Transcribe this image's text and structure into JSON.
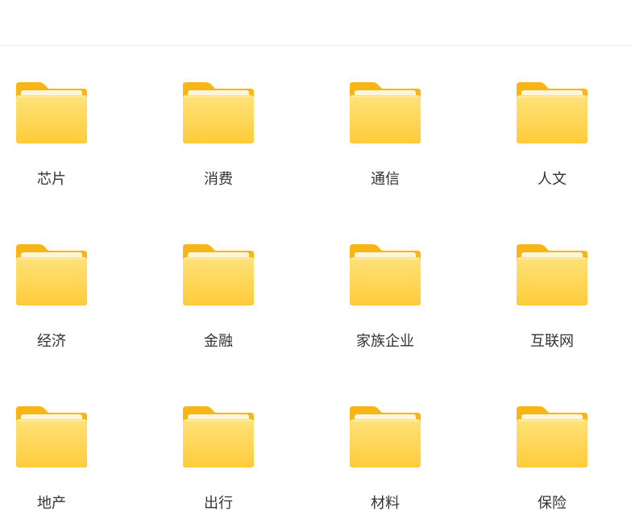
{
  "folders": [
    {
      "label": "芯片"
    },
    {
      "label": "消费"
    },
    {
      "label": "通信"
    },
    {
      "label": "人文"
    },
    {
      "label": "经济"
    },
    {
      "label": "金融"
    },
    {
      "label": "家族企业"
    },
    {
      "label": "互联网"
    },
    {
      "label": "地产"
    },
    {
      "label": "出行"
    },
    {
      "label": "材料"
    },
    {
      "label": "保险"
    }
  ],
  "colors": {
    "folder_back": "#F9B416",
    "folder_front_top": "#FFE27A",
    "folder_front_bottom": "#FFCC3A",
    "paper": "#FFF6DA"
  }
}
